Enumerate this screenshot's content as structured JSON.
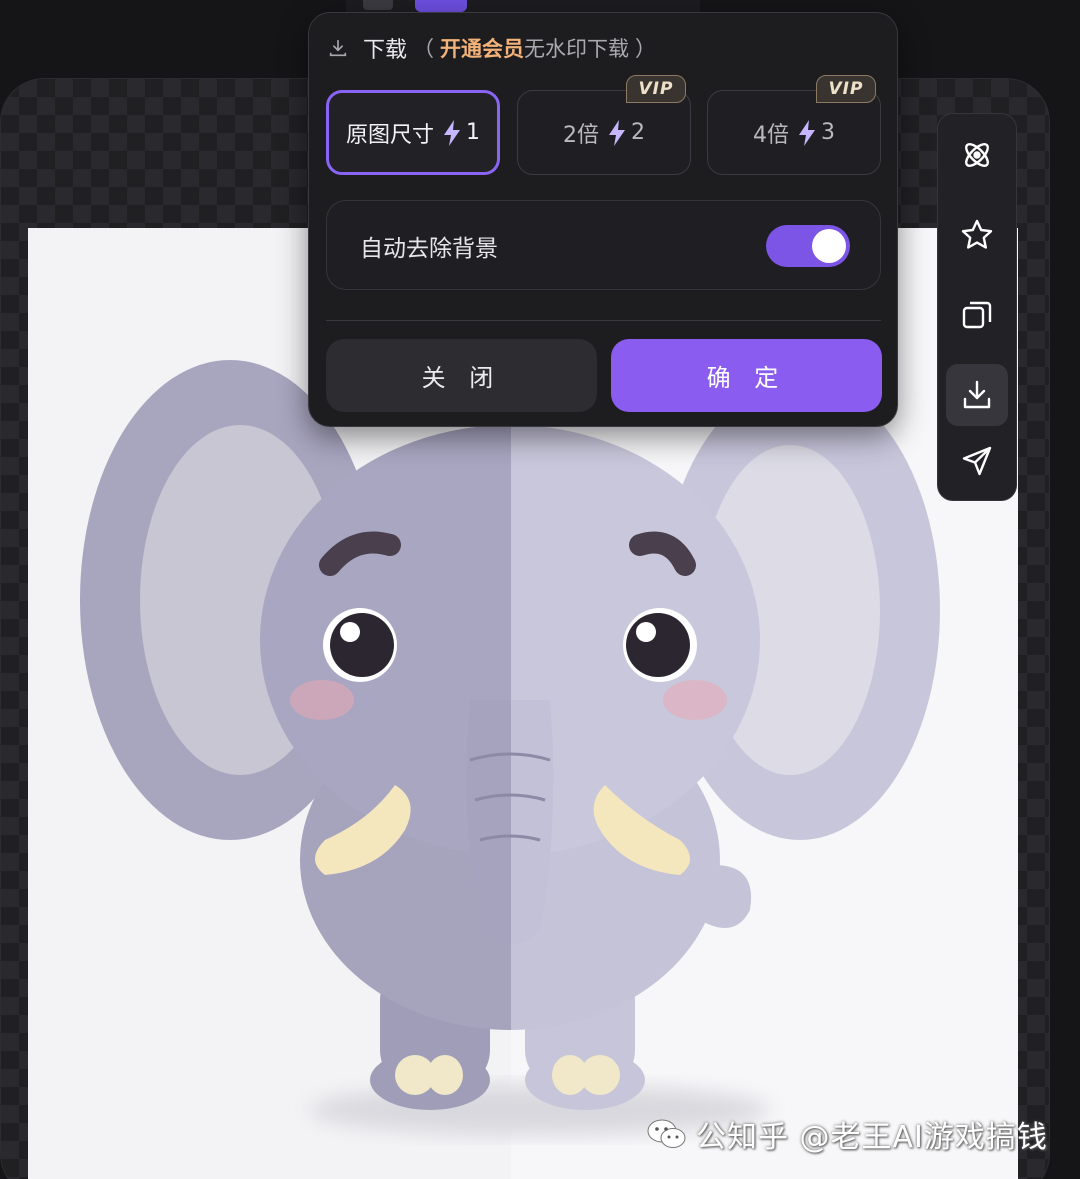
{
  "download_panel": {
    "title": "下载",
    "paren_open": "（",
    "vip_link": "开通会员",
    "no_watermark": "无水印下载",
    "paren_close": "）",
    "size_options": [
      {
        "label": "原图尺寸",
        "cost": "1",
        "selected": true,
        "vip": false
      },
      {
        "label": "2倍",
        "cost": "2",
        "selected": false,
        "vip": true
      },
      {
        "label": "4倍",
        "cost": "3",
        "selected": false,
        "vip": true
      }
    ],
    "vip_badge": "VIP",
    "remove_bg_label": "自动去除背景",
    "remove_bg_on": true,
    "close_label": "关 闭",
    "confirm_label": "确 定"
  },
  "side_toolbar": {
    "items": [
      {
        "icon": "ai-atom-icon"
      },
      {
        "icon": "star-icon"
      },
      {
        "icon": "copy-icon"
      },
      {
        "icon": "download-icon",
        "active": true
      },
      {
        "icon": "send-icon"
      }
    ]
  },
  "watermark": {
    "text": "公知乎 @老王AI游戏搞钱"
  },
  "colors": {
    "accent": "#8a5cf0",
    "vip_gold": "#f2b27a",
    "panel_bg": "#1d1d20"
  }
}
